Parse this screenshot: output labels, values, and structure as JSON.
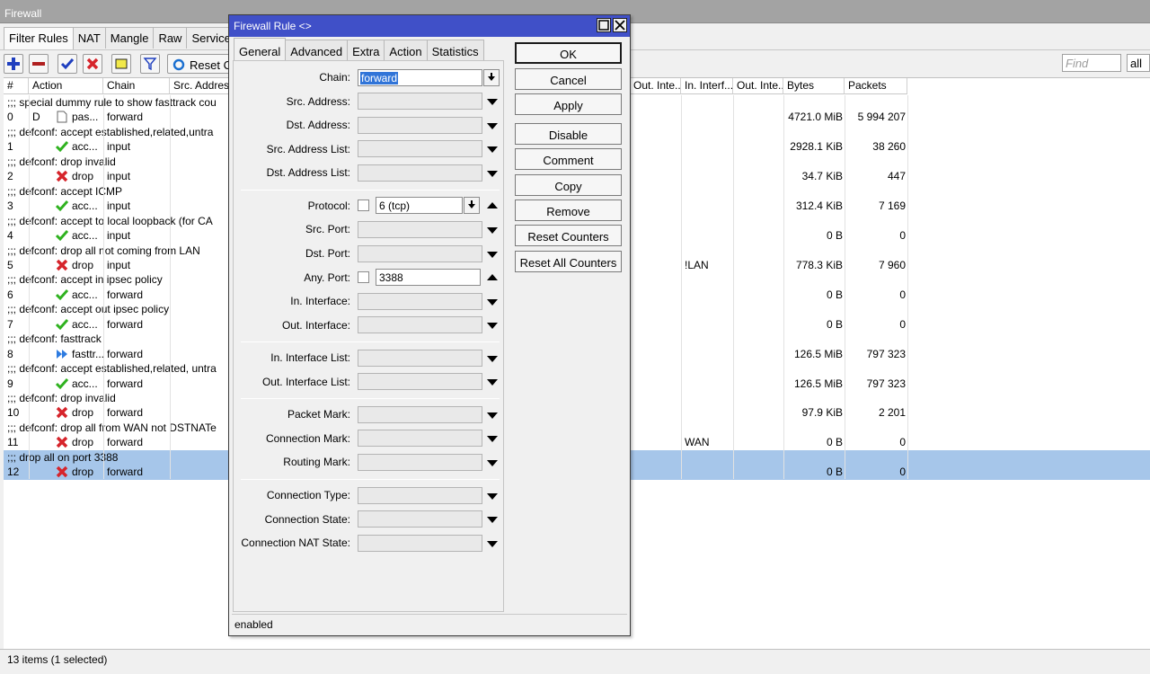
{
  "window": {
    "title": "Firewall"
  },
  "tabs": [
    "Filter Rules",
    "NAT",
    "Mangle",
    "Raw",
    "Service"
  ],
  "toolbar": {
    "reset_label": "Reset C"
  },
  "search": {
    "placeholder": "Find",
    "scope": "all"
  },
  "columns": [
    "#",
    "Action",
    "Chain",
    "Src. Address",
    "Out. Inte...",
    "In. Interf...",
    "Out. Inte...",
    "Bytes",
    "Packets"
  ],
  "rows": [
    {
      "type": "comment",
      "text": ";;; special dummy rule to show fasttrack cou"
    },
    {
      "type": "rule",
      "num": "0",
      "flag": "D",
      "icon": "passthrough-icon",
      "action": "pas...",
      "chain": "forward",
      "in_iface": "",
      "bytes": "4721.0 MiB",
      "packets": "5 994 207"
    },
    {
      "type": "comment",
      "text": ";;; defconf: accept established,related,untra"
    },
    {
      "type": "rule",
      "num": "1",
      "flag": "",
      "icon": "accept-icon",
      "action": "acc...",
      "chain": "input",
      "in_iface": "",
      "bytes": "2928.1 KiB",
      "packets": "38 260"
    },
    {
      "type": "comment",
      "text": ";;; defconf: drop invalid"
    },
    {
      "type": "rule",
      "num": "2",
      "flag": "",
      "icon": "drop-icon",
      "action": "drop",
      "chain": "input",
      "in_iface": "",
      "bytes": "34.7 KiB",
      "packets": "447"
    },
    {
      "type": "comment",
      "text": ";;; defconf: accept ICMP"
    },
    {
      "type": "rule",
      "num": "3",
      "flag": "",
      "icon": "accept-icon",
      "action": "acc...",
      "chain": "input",
      "in_iface": "",
      "bytes": "312.4 KiB",
      "packets": "7 169"
    },
    {
      "type": "comment",
      "text": ";;; defconf: accept to local loopback (for CA"
    },
    {
      "type": "rule",
      "num": "4",
      "flag": "",
      "icon": "accept-icon",
      "action": "acc...",
      "chain": "input",
      "in_iface": "",
      "bytes": "0 B",
      "packets": "0"
    },
    {
      "type": "comment",
      "text": ";;; defconf: drop all not coming from LAN"
    },
    {
      "type": "rule",
      "num": "5",
      "flag": "",
      "icon": "drop-icon",
      "action": "drop",
      "chain": "input",
      "in_iface": "!LAN",
      "bytes": "778.3 KiB",
      "packets": "7 960"
    },
    {
      "type": "comment",
      "text": ";;; defconf: accept in ipsec policy"
    },
    {
      "type": "rule",
      "num": "6",
      "flag": "",
      "icon": "accept-icon",
      "action": "acc...",
      "chain": "forward",
      "in_iface": "",
      "bytes": "0 B",
      "packets": "0"
    },
    {
      "type": "comment",
      "text": ";;; defconf: accept out ipsec policy"
    },
    {
      "type": "rule",
      "num": "7",
      "flag": "",
      "icon": "accept-icon",
      "action": "acc...",
      "chain": "forward",
      "in_iface": "",
      "bytes": "0 B",
      "packets": "0"
    },
    {
      "type": "comment",
      "text": ";;; defconf: fasttrack"
    },
    {
      "type": "rule",
      "num": "8",
      "flag": "",
      "icon": "fasttrack-icon",
      "action": "fasttr...",
      "chain": "forward",
      "in_iface": "",
      "bytes": "126.5 MiB",
      "packets": "797 323"
    },
    {
      "type": "comment",
      "text": ";;; defconf: accept established,related, untra"
    },
    {
      "type": "rule",
      "num": "9",
      "flag": "",
      "icon": "accept-icon",
      "action": "acc...",
      "chain": "forward",
      "in_iface": "",
      "bytes": "126.5 MiB",
      "packets": "797 323"
    },
    {
      "type": "comment",
      "text": ";;; defconf: drop invalid"
    },
    {
      "type": "rule",
      "num": "10",
      "flag": "",
      "icon": "drop-icon",
      "action": "drop",
      "chain": "forward",
      "in_iface": "",
      "bytes": "97.9 KiB",
      "packets": "2 201"
    },
    {
      "type": "comment",
      "text": ";;; defconf: drop all from WAN not DSTNATe"
    },
    {
      "type": "rule",
      "num": "11",
      "flag": "",
      "icon": "drop-icon",
      "action": "drop",
      "chain": "forward",
      "in_iface": "WAN",
      "bytes": "0 B",
      "packets": "0"
    },
    {
      "type": "comment",
      "text": ";;; drop all on port 3388",
      "selected": true
    },
    {
      "type": "rule",
      "num": "12",
      "flag": "",
      "icon": "drop-icon",
      "action": "drop",
      "chain": "forward",
      "in_iface": "",
      "bytes": "0 B",
      "packets": "0",
      "selected": true
    }
  ],
  "status_bar": "13 items (1 selected)",
  "dialog": {
    "title": "Firewall Rule <>",
    "tabs": [
      "General",
      "Advanced",
      "Extra",
      "Action",
      "Statistics"
    ],
    "fields": {
      "chain": {
        "label": "Chain:",
        "value": "forward"
      },
      "src_address": {
        "label": "Src. Address:"
      },
      "dst_address": {
        "label": "Dst. Address:"
      },
      "src_address_list": {
        "label": "Src. Address List:"
      },
      "dst_address_list": {
        "label": "Dst. Address List:"
      },
      "protocol": {
        "label": "Protocol:",
        "value": "6 (tcp)"
      },
      "src_port": {
        "label": "Src. Port:"
      },
      "dst_port": {
        "label": "Dst. Port:"
      },
      "any_port": {
        "label": "Any. Port:",
        "value": "3388"
      },
      "in_interface": {
        "label": "In. Interface:"
      },
      "out_interface": {
        "label": "Out. Interface:"
      },
      "in_interface_list": {
        "label": "In. Interface List:"
      },
      "out_interface_list": {
        "label": "Out. Interface List:"
      },
      "packet_mark": {
        "label": "Packet Mark:"
      },
      "connection_mark": {
        "label": "Connection Mark:"
      },
      "routing_mark": {
        "label": "Routing Mark:"
      },
      "connection_type": {
        "label": "Connection Type:"
      },
      "connection_state": {
        "label": "Connection State:"
      },
      "connection_nat_state": {
        "label": "Connection NAT State:"
      }
    },
    "buttons": [
      "OK",
      "Cancel",
      "Apply",
      "Disable",
      "Comment",
      "Copy",
      "Remove",
      "Reset Counters",
      "Reset All Counters"
    ],
    "status": "enabled"
  },
  "colors": {
    "titlebar": "#a3a3a3",
    "dialog_title": "#4050c8",
    "selection": "#a6c6ea",
    "accept": "#2fb21f",
    "drop": "#d6242b"
  }
}
